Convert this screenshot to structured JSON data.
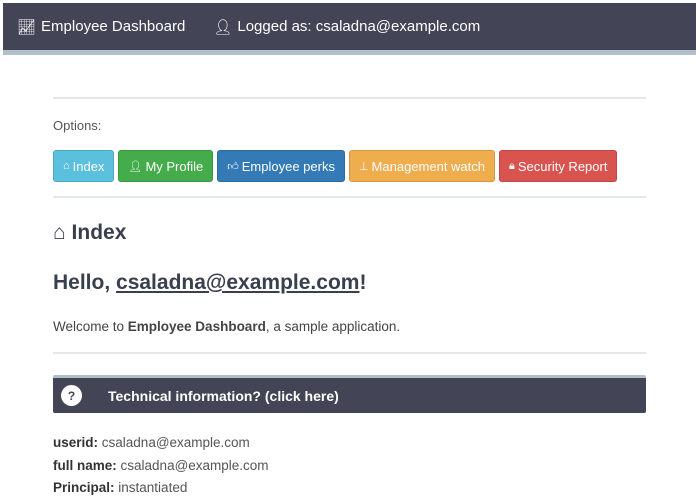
{
  "navbar": {
    "brand": "Employee Dashboard",
    "brand_icon": "line-chart-icon",
    "user_label": "Logged as: csaladna@example.com",
    "user_icon": "user-icon"
  },
  "options_label": "Options:",
  "buttons": [
    {
      "label": "Index",
      "icon": "home-icon",
      "color": "#5bc0de"
    },
    {
      "label": "My Profile",
      "icon": "user-icon",
      "color": "#44ac4a"
    },
    {
      "label": "Employee perks",
      "icon": "thumbs-up-icon",
      "color": "#337ab7"
    },
    {
      "label": "Management watch",
      "icon": "sitemap-icon",
      "color": "#f0ad4e"
    },
    {
      "label": "Security Report",
      "icon": "lock-icon",
      "color": "#d9534f"
    }
  ],
  "heading": "Index",
  "hello_prefix": "Hello, ",
  "hello_user": "csaladna@example.com",
  "hello_suffix": "!",
  "welcome": {
    "prefix": "Welcome to ",
    "app": "Employee Dashboard",
    "suffix": ", a sample application."
  },
  "panel": {
    "icon_text": "?",
    "title": "Technical information? (click here)"
  },
  "info": [
    {
      "label": "userid:",
      "value": "csaladna@example.com"
    },
    {
      "label": "full name:",
      "value": "csaladna@example.com"
    },
    {
      "label": "Principal:",
      "value": "instantiated"
    }
  ]
}
